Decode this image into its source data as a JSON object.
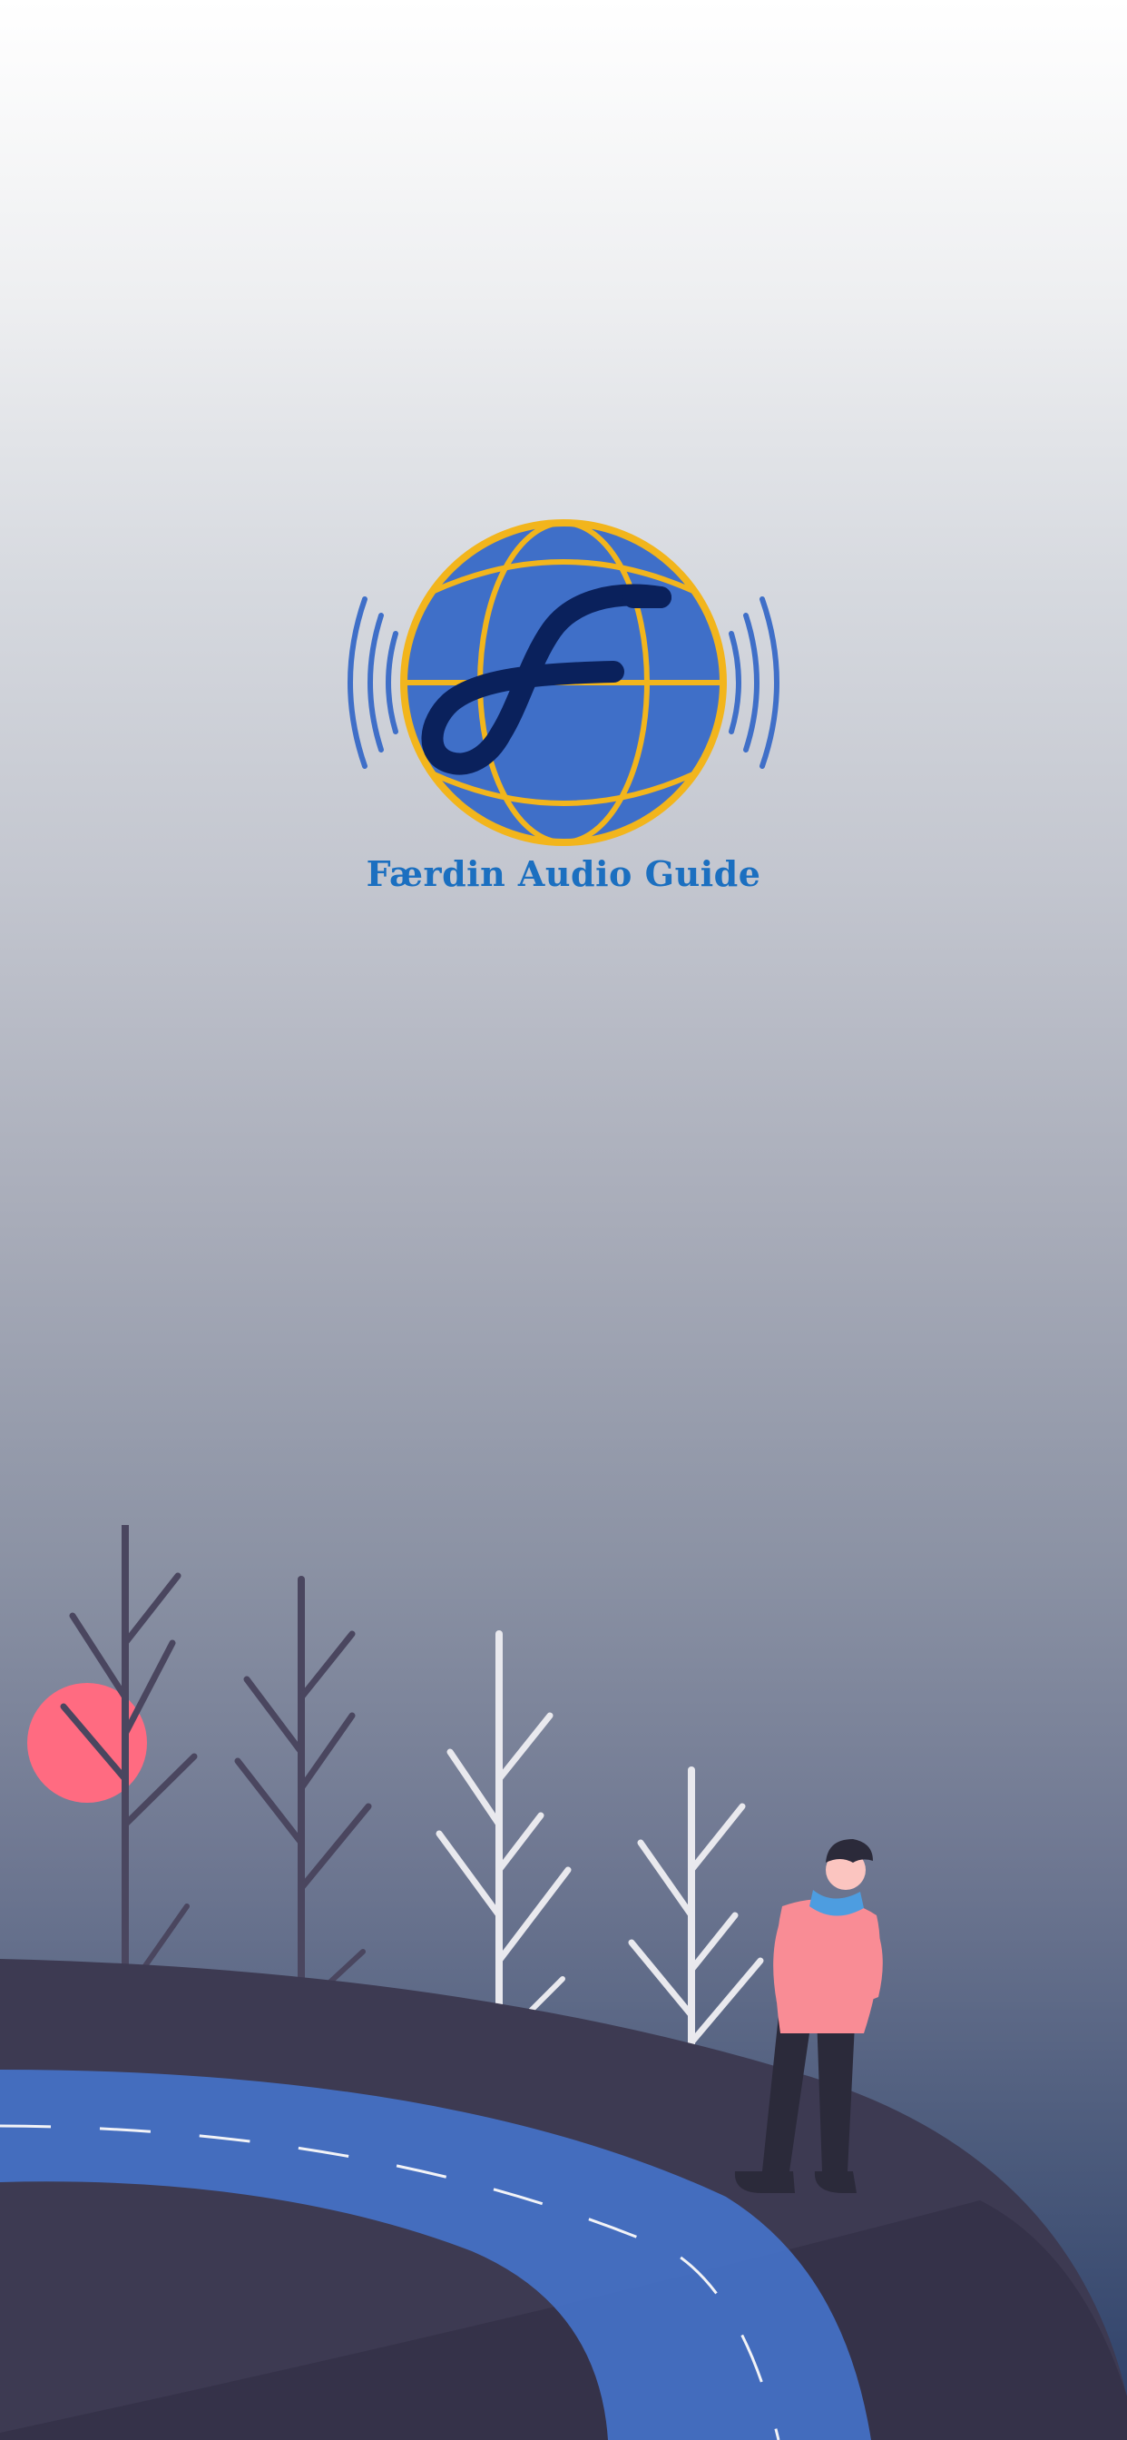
{
  "splash": {
    "app_name": "Færdin Audio Guide",
    "logo_icon": "globe-f-sound-waves-icon",
    "logo_letter": "F"
  },
  "colors": {
    "logo_blue": "#3f6fc8",
    "logo_gold": "#f2b51c",
    "logo_letter": "#0a215c",
    "app_name_text": "#1b6fc0",
    "hill": "#3d3a52",
    "road": "#4470c4",
    "sun": "#ff6b81",
    "person_shirt": "#f98c95"
  },
  "illustration": {
    "name": "person-standing-by-road-illustration",
    "elements": [
      "sun",
      "dark-trees",
      "white-trees",
      "hill",
      "road",
      "person"
    ]
  }
}
